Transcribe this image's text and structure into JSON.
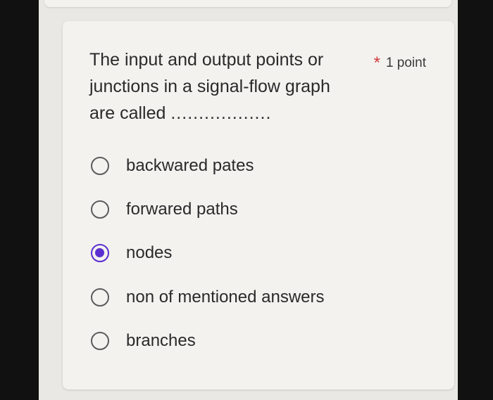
{
  "question": {
    "text": "The input and output points or junctions in a signal-flow graph are called",
    "blank": "..................",
    "required_marker": "*",
    "points": "1 point"
  },
  "options": [
    {
      "label": "backwared pates",
      "selected": false
    },
    {
      "label": "forwared paths",
      "selected": false
    },
    {
      "label": "nodes",
      "selected": true
    },
    {
      "label": "non of mentioned answers",
      "selected": false
    },
    {
      "label": "branches",
      "selected": false
    }
  ],
  "colors": {
    "accent": "#5a2fd0",
    "required": "#d23b3b"
  }
}
